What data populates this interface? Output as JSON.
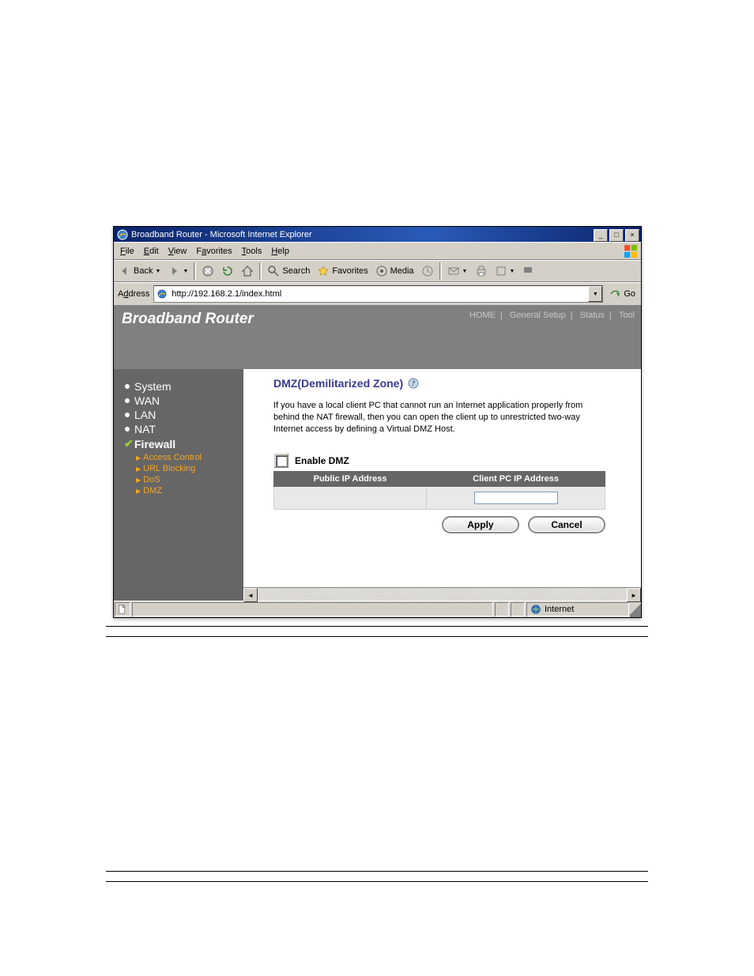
{
  "window": {
    "title": "Broadband Router - Microsoft Internet Explorer"
  },
  "menubar": {
    "file": "File",
    "edit": "Edit",
    "view": "View",
    "favorites": "Favorites",
    "tools": "Tools",
    "help": "Help"
  },
  "toolbar": {
    "back": "Back",
    "search": "Search",
    "favorites": "Favorites",
    "media": "Media"
  },
  "addressbar": {
    "label": "Address",
    "url": "http://192.168.2.1/index.html",
    "go": "Go"
  },
  "router": {
    "title": "Broadband Router",
    "nav": [
      "HOME",
      "General Setup",
      "Status",
      "Tool"
    ]
  },
  "sidebar": {
    "items": [
      "System",
      "WAN",
      "LAN",
      "NAT",
      "Firewall"
    ],
    "firewall_sub": [
      "Access Control",
      "URL Blocking",
      "DoS",
      "DMZ"
    ]
  },
  "main": {
    "title": "DMZ(Demilitarized Zone)",
    "description": "If you have a local client PC that cannot run an Internet application properly from behind the NAT firewall, then you can open the client up to unrestricted two-way Internet access by defining a Virtual DMZ Host.",
    "enable_label": "Enable DMZ",
    "table": {
      "col1": "Public IP Address",
      "col2": "Client PC IP Address",
      "row_value": ""
    },
    "buttons": {
      "apply": "Apply",
      "cancel": "Cancel"
    }
  },
  "statusbar": {
    "zone": "Internet"
  }
}
